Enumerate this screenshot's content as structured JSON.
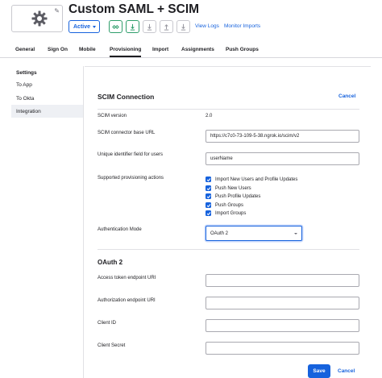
{
  "app": {
    "title": "Custom SAML + SCIM",
    "status_label": "Active",
    "view_logs": "View Logs",
    "monitor_imports": "Monitor Imports",
    "logo_icon": "gear-icon"
  },
  "tabs": [
    {
      "label": "General"
    },
    {
      "label": "Sign On"
    },
    {
      "label": "Mobile"
    },
    {
      "label": "Provisioning",
      "active": true
    },
    {
      "label": "Import"
    },
    {
      "label": "Assignments"
    },
    {
      "label": "Push Groups"
    }
  ],
  "sidebar": {
    "heading": "Settings",
    "items": [
      {
        "label": "To App"
      },
      {
        "label": "To Okta"
      },
      {
        "label": "Integration",
        "active": true
      }
    ]
  },
  "scim": {
    "title": "SCIM Connection",
    "cancel": "Cancel",
    "version_label": "SCIM version",
    "version_value": "2.0",
    "base_url_label": "SCIM connector base URL",
    "base_url_value": "https://c7c0-73-109-5-38.ngrok.io/scim/v2",
    "unique_id_label": "Unique identifier field for users",
    "unique_id_value": "userName",
    "actions_label": "Supported provisioning actions",
    "actions": [
      {
        "label": "Import New Users and Profile Updates",
        "checked": true
      },
      {
        "label": "Push New Users",
        "checked": true
      },
      {
        "label": "Push Profile Updates",
        "checked": true
      },
      {
        "label": "Push Groups",
        "checked": true
      },
      {
        "label": "Import Groups",
        "checked": true
      }
    ],
    "auth_mode_label": "Authentication Mode",
    "auth_mode_value": "OAuth 2"
  },
  "oauth": {
    "title": "OAuth 2",
    "token_uri_label": "Access token endpoint URI",
    "token_uri_value": "",
    "auth_uri_label": "Authorization endpoint URI",
    "auth_uri_value": "",
    "client_id_label": "Client ID",
    "client_id_value": "",
    "client_secret_label": "Client Secret",
    "client_secret_value": ""
  },
  "footer": {
    "save": "Save",
    "cancel": "Cancel"
  },
  "colors": {
    "accent": "#1662dd",
    "success": "#2f9e6b"
  }
}
